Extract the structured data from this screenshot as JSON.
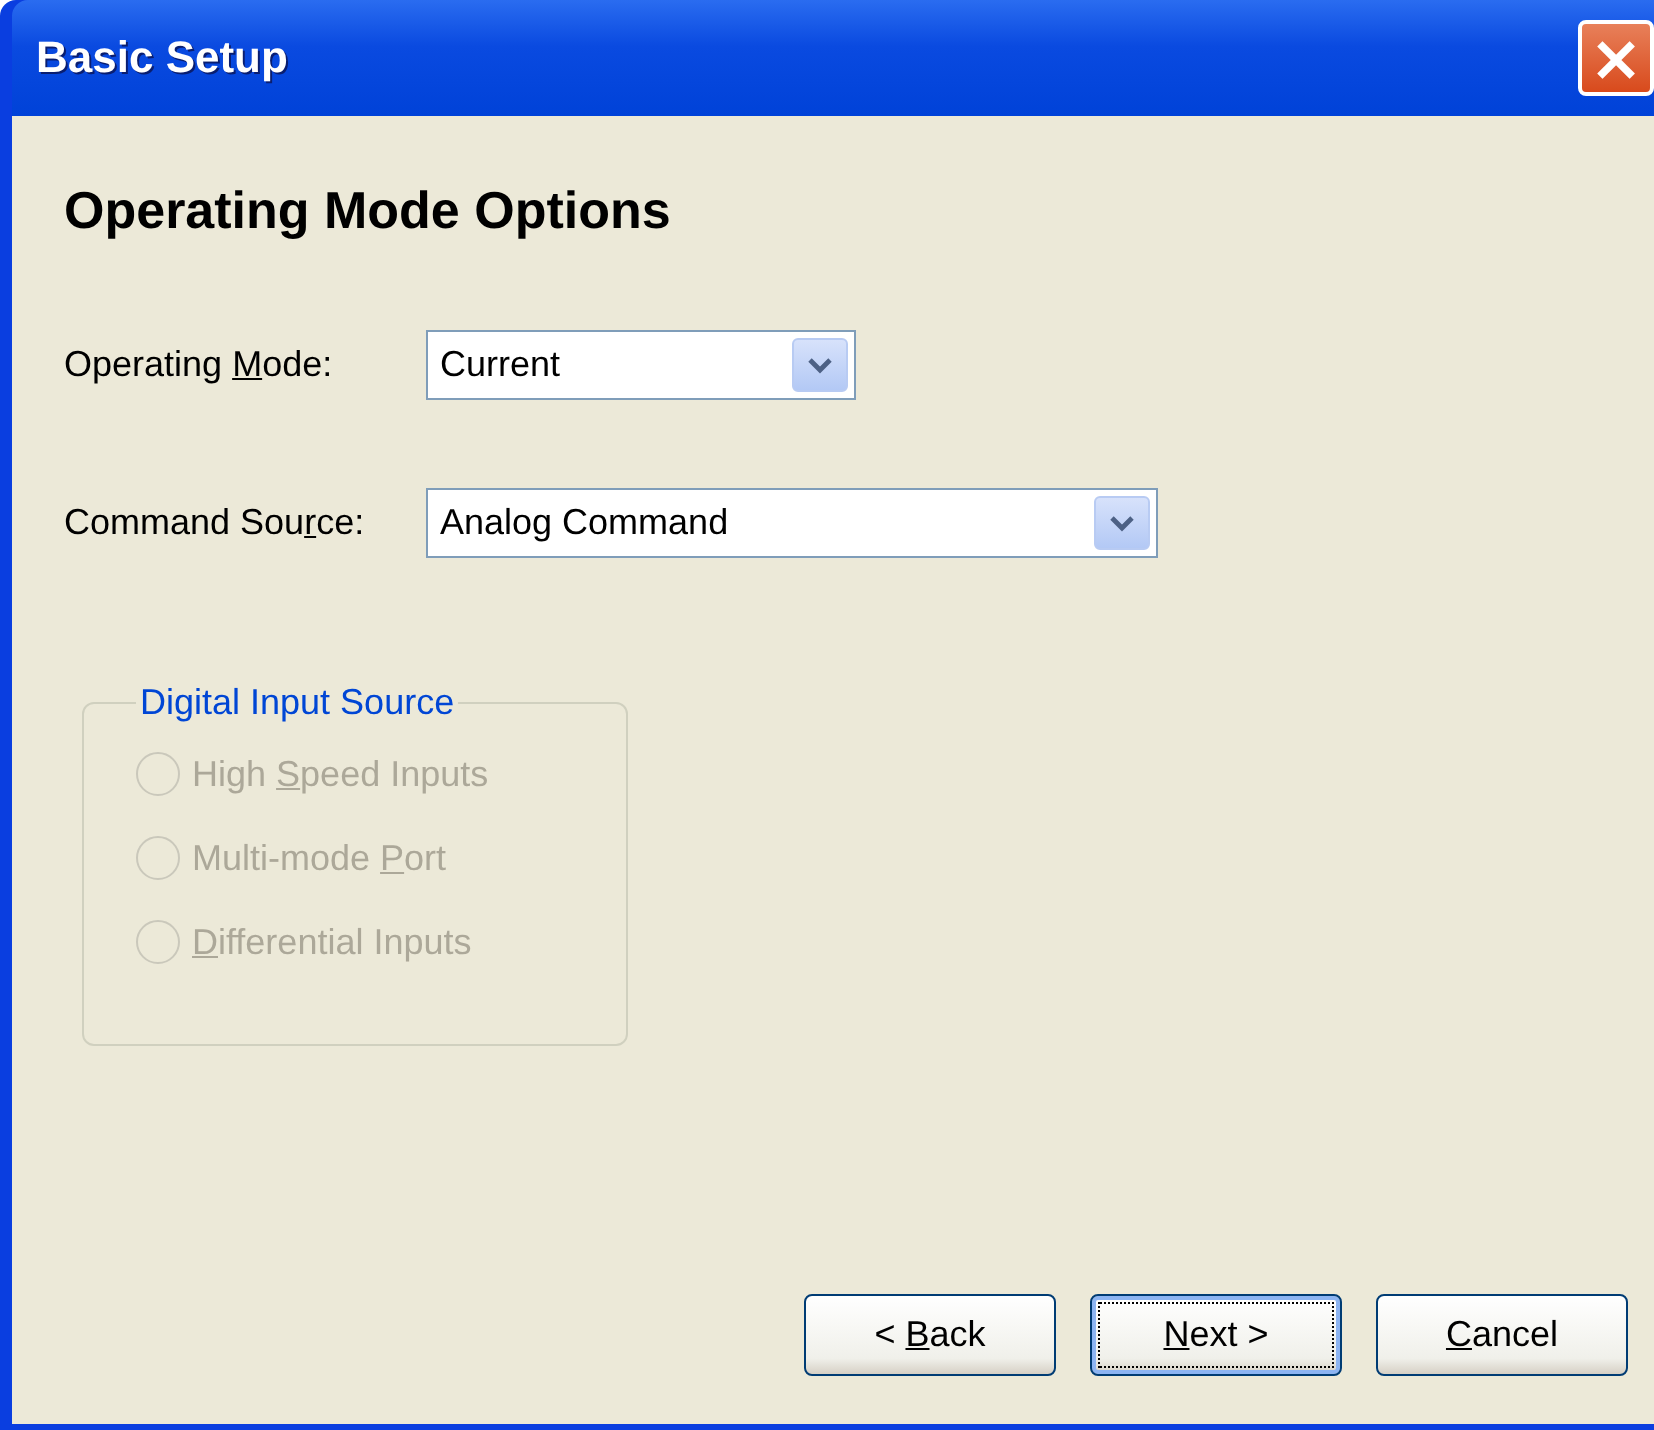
{
  "window": {
    "title": "Basic Setup",
    "close_label": "×"
  },
  "heading": "Operating Mode Options",
  "fields": [
    {
      "label_before": "Operating ",
      "mnemonic": "M",
      "label_after": "ode:",
      "value": "Current",
      "kind": "short"
    },
    {
      "label_before": "Command Sou",
      "mnemonic": "r",
      "label_after": "ce:",
      "value": "Analog Command",
      "kind": "wide"
    }
  ],
  "group": {
    "title": "Digital Input Source",
    "disabled": true,
    "options": [
      {
        "label_before": "High ",
        "mnemonic": "S",
        "label_after": "peed Inputs",
        "selected": false
      },
      {
        "label_before": "Multi-mode ",
        "mnemonic": "P",
        "label_after": "ort",
        "selected": false
      },
      {
        "mnemonic": "D",
        "label_after": "ifferential Inputs",
        "selected": false
      }
    ]
  },
  "buttons": [
    {
      "label_before": "< ",
      "mnemonic": "B",
      "label_after": "ack",
      "focused": false
    },
    {
      "mnemonic": "N",
      "label_after": "ext >",
      "focused": true
    },
    {
      "mnemonic": "C",
      "label_after": "ancel",
      "focused": false
    }
  ]
}
